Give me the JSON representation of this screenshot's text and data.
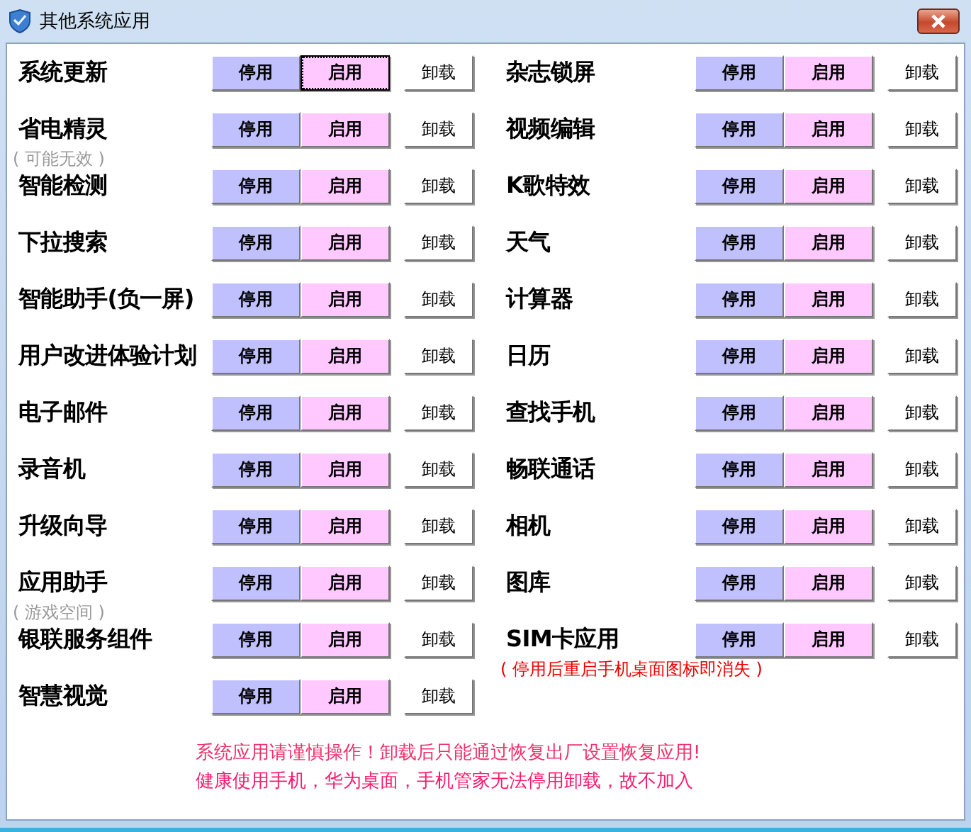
{
  "window": {
    "title": "其他系统应用"
  },
  "columns": [
    {
      "apps": [
        {
          "name": "系统更新",
          "buttons": [
            {
              "label": "停用",
              "kind": "disable",
              "focused": false
            },
            {
              "label": "启用",
              "kind": "enable",
              "focused": true
            },
            {
              "label": "卸载",
              "kind": "uninstall",
              "focused": false
            }
          ]
        },
        {
          "name": "省电精灵",
          "note": {
            "text": "( 可能无效 )",
            "kind": "hint"
          },
          "buttons": [
            {
              "label": "停用",
              "kind": "disable",
              "focused": false
            },
            {
              "label": "启用",
              "kind": "enable",
              "focused": false
            },
            {
              "label": "卸载",
              "kind": "uninstall",
              "focused": false
            }
          ]
        },
        {
          "name": "智能检测",
          "buttons": [
            {
              "label": "停用",
              "kind": "disable",
              "focused": false
            },
            {
              "label": "启用",
              "kind": "enable",
              "focused": false
            },
            {
              "label": "卸载",
              "kind": "uninstall",
              "focused": false
            }
          ]
        },
        {
          "name": "下拉搜索",
          "buttons": [
            {
              "label": "停用",
              "kind": "disable",
              "focused": false
            },
            {
              "label": "启用",
              "kind": "enable",
              "focused": false
            },
            {
              "label": "卸载",
              "kind": "uninstall",
              "focused": false
            }
          ]
        },
        {
          "name": "智能助手(负一屏)",
          "buttons": [
            {
              "label": "停用",
              "kind": "disable",
              "focused": false
            },
            {
              "label": "启用",
              "kind": "enable",
              "focused": false
            },
            {
              "label": "卸载",
              "kind": "uninstall",
              "focused": false
            }
          ]
        },
        {
          "name": "用户改进体验计划",
          "buttons": [
            {
              "label": "停用",
              "kind": "disable",
              "focused": false
            },
            {
              "label": "启用",
              "kind": "enable",
              "focused": false
            },
            {
              "label": "卸载",
              "kind": "uninstall",
              "focused": false
            }
          ]
        },
        {
          "name": "电子邮件",
          "buttons": [
            {
              "label": "停用",
              "kind": "disable",
              "focused": false
            },
            {
              "label": "启用",
              "kind": "enable",
              "focused": false
            },
            {
              "label": "卸载",
              "kind": "uninstall",
              "focused": false
            }
          ]
        },
        {
          "name": "录音机",
          "buttons": [
            {
              "label": "停用",
              "kind": "disable",
              "focused": false
            },
            {
              "label": "启用",
              "kind": "enable",
              "focused": false
            },
            {
              "label": "卸载",
              "kind": "uninstall",
              "focused": false
            }
          ]
        },
        {
          "name": "升级向导",
          "buttons": [
            {
              "label": "停用",
              "kind": "disable",
              "focused": false
            },
            {
              "label": "启用",
              "kind": "enable",
              "focused": false
            },
            {
              "label": "卸载",
              "kind": "uninstall",
              "focused": false
            }
          ]
        },
        {
          "name": "应用助手",
          "note": {
            "text": "( 游戏空间 )",
            "kind": "hint"
          },
          "buttons": [
            {
              "label": "停用",
              "kind": "disable",
              "focused": false
            },
            {
              "label": "启用",
              "kind": "enable",
              "focused": false
            },
            {
              "label": "卸载",
              "kind": "uninstall",
              "focused": false
            }
          ]
        },
        {
          "name": "银联服务组件",
          "buttons": [
            {
              "label": "停用",
              "kind": "disable",
              "focused": false
            },
            {
              "label": "启用",
              "kind": "enable",
              "focused": false
            },
            {
              "label": "卸载",
              "kind": "uninstall",
              "focused": false
            }
          ]
        },
        {
          "name": "智慧视觉",
          "buttons": [
            {
              "label": "停用",
              "kind": "disable",
              "focused": false
            },
            {
              "label": "启用",
              "kind": "enable",
              "focused": false
            },
            {
              "label": "卸载",
              "kind": "uninstall",
              "focused": false
            }
          ]
        }
      ]
    },
    {
      "apps": [
        {
          "name": "杂志锁屏",
          "buttons": [
            {
              "label": "停用",
              "kind": "disable",
              "focused": false
            },
            {
              "label": "启用",
              "kind": "enable",
              "focused": false
            },
            {
              "label": "卸载",
              "kind": "uninstall",
              "focused": false
            }
          ]
        },
        {
          "name": "视频编辑",
          "buttons": [
            {
              "label": "停用",
              "kind": "disable",
              "focused": false
            },
            {
              "label": "启用",
              "kind": "enable",
              "focused": false
            },
            {
              "label": "卸载",
              "kind": "uninstall",
              "focused": false
            }
          ]
        },
        {
          "name": "K歌特效",
          "buttons": [
            {
              "label": "停用",
              "kind": "disable",
              "focused": false
            },
            {
              "label": "启用",
              "kind": "enable",
              "focused": false
            },
            {
              "label": "卸载",
              "kind": "uninstall",
              "focused": false
            }
          ]
        },
        {
          "name": "天气",
          "buttons": [
            {
              "label": "停用",
              "kind": "disable",
              "focused": false
            },
            {
              "label": "启用",
              "kind": "enable",
              "focused": false
            },
            {
              "label": "卸载",
              "kind": "uninstall",
              "focused": false
            }
          ]
        },
        {
          "name": "计算器",
          "buttons": [
            {
              "label": "停用",
              "kind": "disable",
              "focused": false
            },
            {
              "label": "启用",
              "kind": "enable",
              "focused": false
            },
            {
              "label": "卸载",
              "kind": "uninstall",
              "focused": false
            }
          ]
        },
        {
          "name": "日历",
          "buttons": [
            {
              "label": "停用",
              "kind": "disable",
              "focused": false
            },
            {
              "label": "启用",
              "kind": "enable",
              "focused": false
            },
            {
              "label": "卸载",
              "kind": "uninstall",
              "focused": false
            }
          ]
        },
        {
          "name": "查找手机",
          "buttons": [
            {
              "label": "停用",
              "kind": "disable",
              "focused": false
            },
            {
              "label": "启用",
              "kind": "enable",
              "focused": false
            },
            {
              "label": "卸载",
              "kind": "uninstall",
              "focused": false
            }
          ]
        },
        {
          "name": "畅联通话",
          "buttons": [
            {
              "label": "停用",
              "kind": "disable",
              "focused": false
            },
            {
              "label": "启用",
              "kind": "enable",
              "focused": false
            },
            {
              "label": "卸载",
              "kind": "uninstall",
              "focused": false
            }
          ]
        },
        {
          "name": "相机",
          "buttons": [
            {
              "label": "停用",
              "kind": "disable",
              "focused": false
            },
            {
              "label": "启用",
              "kind": "enable",
              "focused": false
            },
            {
              "label": "卸载",
              "kind": "uninstall",
              "focused": false
            }
          ]
        },
        {
          "name": "图库",
          "buttons": [
            {
              "label": "停用",
              "kind": "disable",
              "focused": false
            },
            {
              "label": "启用",
              "kind": "enable",
              "focused": false
            },
            {
              "label": "卸载",
              "kind": "uninstall",
              "focused": false
            }
          ]
        },
        {
          "name": "SIM卡应用",
          "note": {
            "text": "( 停用后重启手机桌面图标即消失 )",
            "kind": "warning"
          },
          "buttons": [
            {
              "label": "停用",
              "kind": "disable",
              "focused": false
            },
            {
              "label": "启用",
              "kind": "enable",
              "focused": false
            },
            {
              "label": "卸载",
              "kind": "uninstall",
              "focused": false
            }
          ]
        }
      ]
    }
  ],
  "footer": [
    "系统应用请谨慎操作！卸载后只能通过恢复出厂设置恢复应用!",
    "健康使用手机，华为桌面，手机管家无法停用卸载，故不加入"
  ]
}
